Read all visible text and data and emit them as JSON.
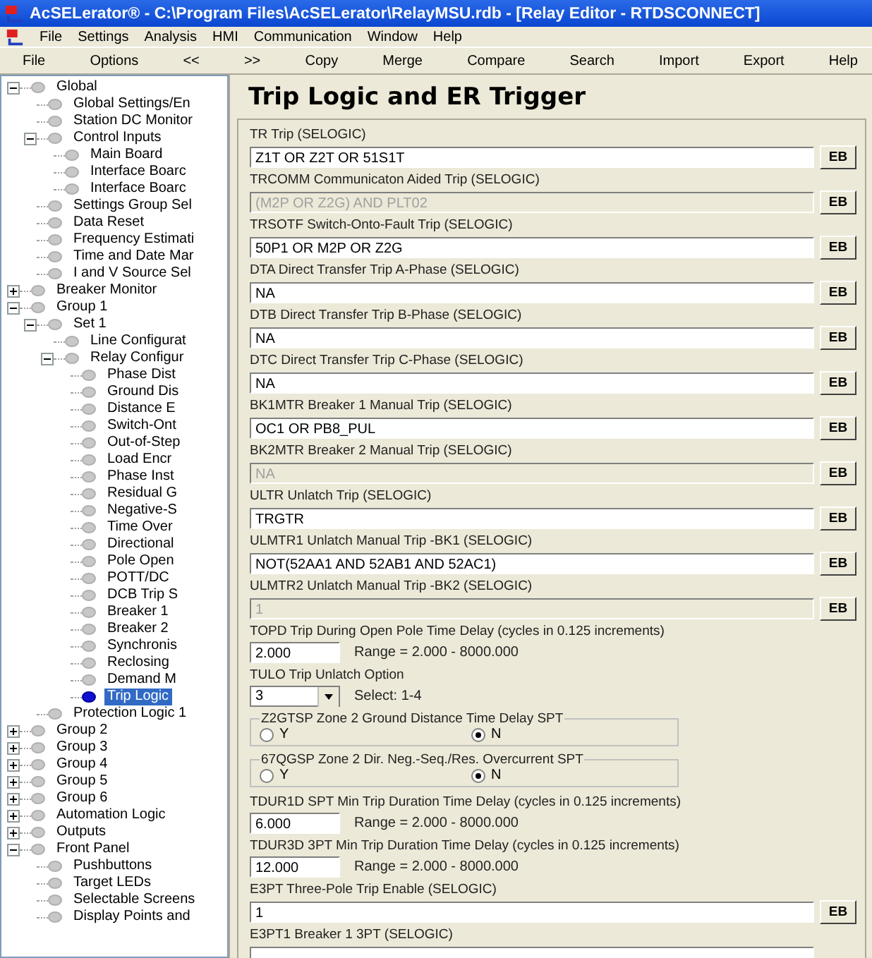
{
  "window": {
    "title": "AcSELerator® - C:\\Program Files\\AcSELerator\\RelayMSU.rdb - [Relay Editor - RTDSCONNECT]"
  },
  "menu": [
    "File",
    "Settings",
    "Analysis",
    "HMI",
    "Communication",
    "Window",
    "Help"
  ],
  "toolbar": [
    "File",
    "Options",
    "<<",
    ">>",
    "Copy",
    "Merge",
    "Compare",
    "Search",
    "Import",
    "Export",
    "Help"
  ],
  "tree": [
    {
      "label": "Global",
      "expanded": true,
      "selected": false,
      "children": [
        {
          "label": "Global Settings/En",
          "selected": false
        },
        {
          "label": "Station DC Monitor",
          "selected": false
        },
        {
          "label": "Control Inputs",
          "expanded": true,
          "selected": false,
          "children": [
            {
              "label": "Main Board",
              "selected": false
            },
            {
              "label": "Interface Boarc",
              "selected": false
            },
            {
              "label": "Interface Boarc",
              "selected": false
            }
          ]
        },
        {
          "label": "Settings Group Sel",
          "selected": false
        },
        {
          "label": "Data Reset",
          "selected": false
        },
        {
          "label": "Frequency Estimati",
          "selected": false
        },
        {
          "label": "Time and Date Mar",
          "selected": false
        },
        {
          "label": "I and V Source Sel",
          "selected": false
        }
      ]
    },
    {
      "label": "Breaker Monitor",
      "expanded": false,
      "selected": false
    },
    {
      "label": "Group 1",
      "expanded": true,
      "selected": false,
      "children": [
        {
          "label": "Set 1",
          "expanded": true,
          "selected": false,
          "children": [
            {
              "label": "Line Configurat",
              "selected": false
            },
            {
              "label": "Relay Configur",
              "expanded": true,
              "selected": false,
              "children": [
                {
                  "label": "Phase Dist",
                  "selected": false
                },
                {
                  "label": "Ground Dis",
                  "selected": false
                },
                {
                  "label": "Distance E",
                  "selected": false
                },
                {
                  "label": "Switch-Ont",
                  "selected": false
                },
                {
                  "label": "Out-of-Step",
                  "selected": false
                },
                {
                  "label": "Load Encr",
                  "selected": false
                },
                {
                  "label": "Phase Inst",
                  "selected": false
                },
                {
                  "label": "Residual G",
                  "selected": false
                },
                {
                  "label": "Negative-S",
                  "selected": false
                },
                {
                  "label": "Time Over",
                  "selected": false
                },
                {
                  "label": "Directional",
                  "selected": false
                },
                {
                  "label": "Pole Open",
                  "selected": false
                },
                {
                  "label": "POTT/DC",
                  "selected": false
                },
                {
                  "label": "DCB Trip S",
                  "selected": false
                },
                {
                  "label": "Breaker 1",
                  "selected": false
                },
                {
                  "label": "Breaker 2",
                  "selected": false
                },
                {
                  "label": "Synchronis",
                  "selected": false
                },
                {
                  "label": "Reclosing",
                  "selected": false
                },
                {
                  "label": "Demand M",
                  "selected": false
                },
                {
                  "label": "Trip Logic",
                  "selected": true
                }
              ]
            }
          ]
        },
        {
          "label": "Protection Logic 1",
          "selected": false
        }
      ]
    },
    {
      "label": "Group 2",
      "expanded": false,
      "selected": false
    },
    {
      "label": "Group 3",
      "expanded": false,
      "selected": false
    },
    {
      "label": "Group 4",
      "expanded": false,
      "selected": false
    },
    {
      "label": "Group 5",
      "expanded": false,
      "selected": false
    },
    {
      "label": "Group 6",
      "expanded": false,
      "selected": false
    },
    {
      "label": "Automation Logic",
      "expanded": false,
      "selected": false
    },
    {
      "label": "Outputs",
      "expanded": false,
      "selected": false
    },
    {
      "label": "Front Panel",
      "expanded": true,
      "selected": false,
      "children": [
        {
          "label": "Pushbuttons",
          "selected": false
        },
        {
          "label": "Target LEDs",
          "selected": false
        },
        {
          "label": "Selectable Screens",
          "selected": false
        },
        {
          "label": "Display Points and",
          "selected": false
        }
      ]
    }
  ],
  "form": {
    "title": "Trip Logic and ER Trigger",
    "settings": [
      {
        "kind": "logic",
        "label": "TR Trip (SELOGIC)",
        "value": "Z1T OR Z2T OR 51S1T",
        "disabled": false,
        "button": "EB"
      },
      {
        "kind": "logic",
        "label": "TRCOMM Communicaton Aided Trip (SELOGIC)",
        "value": "(M2P OR Z2G) AND PLT02",
        "disabled": true,
        "button": "EB"
      },
      {
        "kind": "logic",
        "label": "TRSOTF Switch-Onto-Fault Trip (SELOGIC)",
        "value": "50P1 OR M2P OR Z2G",
        "disabled": false,
        "button": "EB"
      },
      {
        "kind": "logic",
        "label": "DTA Direct Transfer Trip A-Phase (SELOGIC)",
        "value": "NA",
        "disabled": false,
        "button": "EB"
      },
      {
        "kind": "logic",
        "label": "DTB Direct Transfer Trip B-Phase (SELOGIC)",
        "value": "NA",
        "disabled": false,
        "button": "EB"
      },
      {
        "kind": "logic",
        "label": "DTC Direct Transfer Trip C-Phase (SELOGIC)",
        "value": "NA",
        "disabled": false,
        "button": "EB"
      },
      {
        "kind": "logic",
        "label": "BK1MTR Breaker 1 Manual Trip (SELOGIC)",
        "value": "OC1 OR PB8_PUL",
        "disabled": false,
        "button": "EB"
      },
      {
        "kind": "logic",
        "label": "BK2MTR Breaker 2 Manual Trip (SELOGIC)",
        "value": "NA",
        "disabled": true,
        "button": "EB"
      },
      {
        "kind": "logic",
        "label": "ULTR Unlatch Trip (SELOGIC)",
        "value": "TRGTR",
        "disabled": false,
        "button": "EB"
      },
      {
        "kind": "logic",
        "label": "ULMTR1 Unlatch Manual Trip -BK1 (SELOGIC)",
        "value": "NOT(52AA1 AND 52AB1 AND 52AC1)",
        "disabled": false,
        "button": "EB"
      },
      {
        "kind": "logic",
        "label": "ULMTR2 Unlatch Manual Trip -BK2 (SELOGIC)",
        "value": "1",
        "disabled": true,
        "button": "EB"
      },
      {
        "kind": "number",
        "label": "TOPD Trip During Open Pole Time Delay (cycles in 0.125 increments)",
        "value": "2.000",
        "range": "Range = 2.000 - 8000.000"
      },
      {
        "kind": "select",
        "label": "TULO Trip Unlatch Option",
        "value": "3",
        "range": "Select: 1-4"
      },
      {
        "kind": "radio",
        "label": "Z2GTSP Zone 2 Ground Distance Time Delay SPT",
        "options": [
          {
            "label": "Y",
            "selected": false
          },
          {
            "label": "N",
            "selected": true
          }
        ]
      },
      {
        "kind": "radio",
        "label": "67QGSP Zone 2 Dir. Neg.-Seq./Res. Overcurrent SPT",
        "options": [
          {
            "label": "Y",
            "selected": false
          },
          {
            "label": "N",
            "selected": true
          }
        ]
      },
      {
        "kind": "number",
        "label": "TDUR1D SPT Min Trip Duration Time Delay (cycles in 0.125 increments)",
        "value": "6.000",
        "range": "Range = 2.000 - 8000.000"
      },
      {
        "kind": "number",
        "label": "TDUR3D 3PT Min Trip Duration Time Delay (cycles in 0.125 increments)",
        "value": "12.000",
        "range": "Range = 2.000 - 8000.000"
      },
      {
        "kind": "logic",
        "label": "E3PT Three-Pole Trip Enable (SELOGIC)",
        "value": "1",
        "disabled": false,
        "button": "EB"
      },
      {
        "kind": "logic",
        "label": "E3PT1 Breaker 1 3PT (SELOGIC)",
        "disabled": false
      }
    ]
  }
}
